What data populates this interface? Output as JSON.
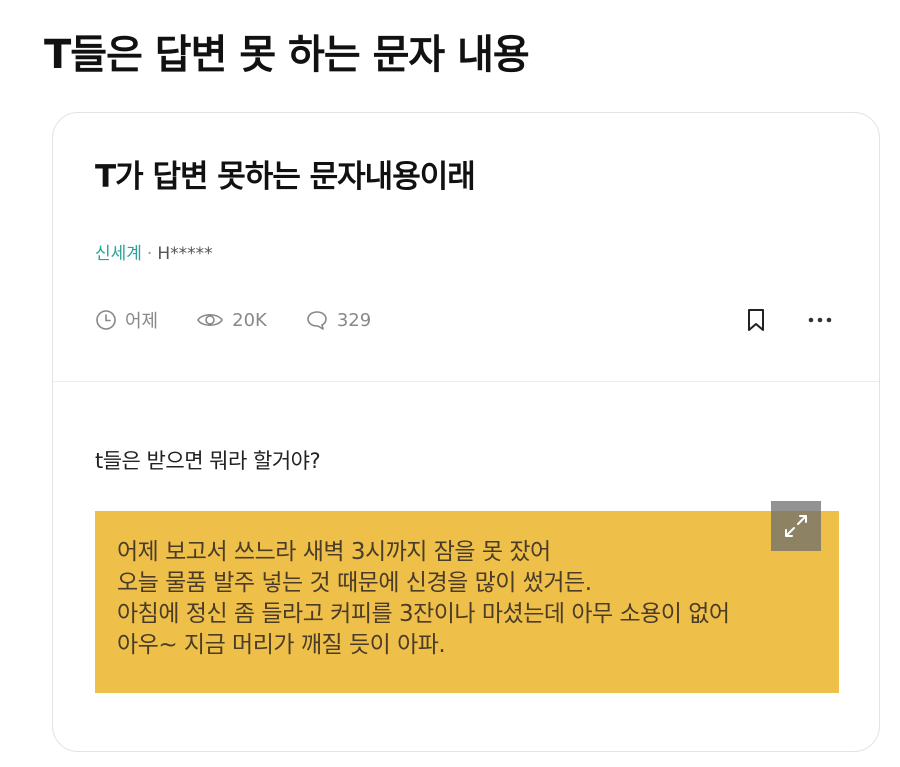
{
  "page": {
    "title": "T들은 답변 못 하는 문자 내용"
  },
  "post": {
    "title": "T가 답변 못하는 문자내용이래",
    "board": "신세계",
    "separator": "·",
    "author": "H*****",
    "time": "어제",
    "views": "20K",
    "comments": "329",
    "body_text": "t들은 받으면 뭐라 할거야?"
  },
  "image_text": {
    "lines": [
      "어제 보고서 쓰느라 새벽 3시까지 잠을 못 잤어",
      "오늘 물품 발주 넣는 것 때문에 신경을 많이 썼거든.",
      "아침에 정신 좀 들라고 커피를 3잔이나 마셨는데 아무 소용이 없어",
      "아우~ 지금 머리가 깨질 듯이 아파."
    ]
  },
  "icons": {
    "time": "clock-icon",
    "views": "eye-icon",
    "comments": "comment-icon",
    "bookmark": "bookmark-icon",
    "more": "more-icon",
    "expand": "expand-icon"
  },
  "colors": {
    "board": "#2aa39a",
    "image_background": "#eec04a",
    "meta_gray": "#888888"
  }
}
